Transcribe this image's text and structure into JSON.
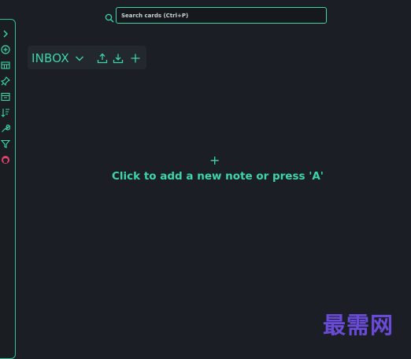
{
  "search": {
    "placeholder": "Search cards (Ctrl+P)",
    "value": ""
  },
  "column": {
    "title": "INBOX"
  },
  "empty_state": {
    "plus": "+",
    "message": "Click to add a new note or press 'A'"
  },
  "watermark": {
    "text": "最需网"
  },
  "sidebar": {
    "icons": [
      "chevron-right-icon",
      "add-circle-icon",
      "board-icon",
      "pin-icon",
      "archive-icon",
      "sort-icon",
      "wrench-icon",
      "filter-icon",
      "github-icon"
    ]
  },
  "colors": {
    "background": "#1b1e24",
    "accent": "#3dd6a8",
    "github": "#e0446b",
    "watermark": "#6a4bd8"
  }
}
